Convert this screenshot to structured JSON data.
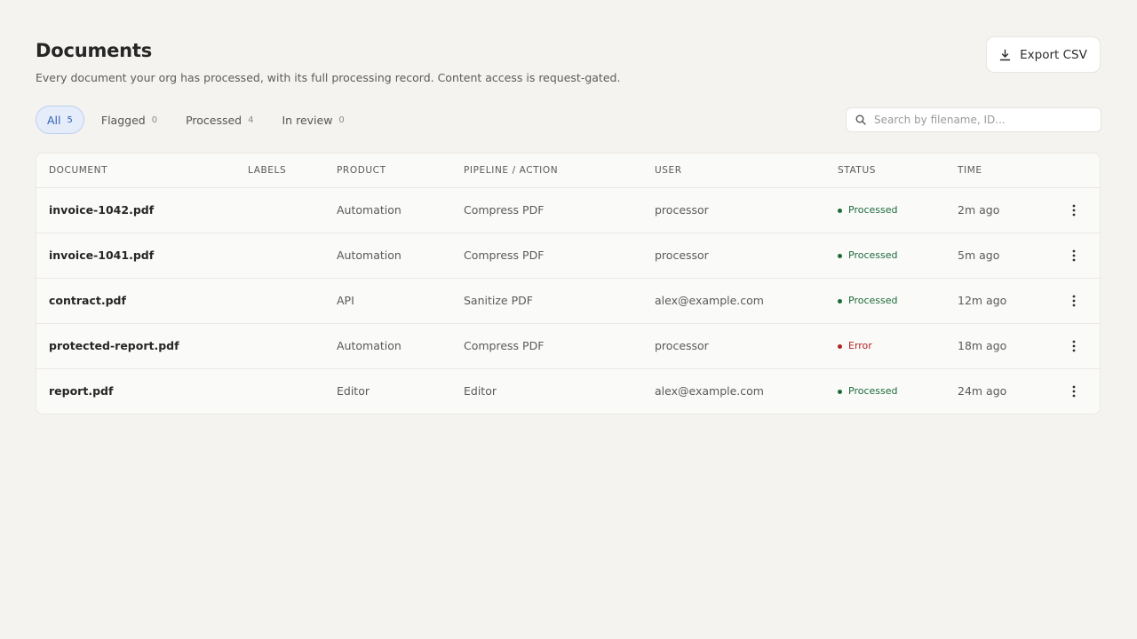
{
  "header": {
    "title": "Documents",
    "subtitle": "Every document your org has processed, with its full processing record. Content access is request-gated.",
    "export_label": "Export CSV",
    "export_icon": "download-icon"
  },
  "filters": [
    {
      "label": "All",
      "count": "5",
      "active": true
    },
    {
      "label": "Flagged",
      "count": "0",
      "active": false
    },
    {
      "label": "Processed",
      "count": "4",
      "active": false
    },
    {
      "label": "In review",
      "count": "0",
      "active": false
    }
  ],
  "search": {
    "placeholder": "Search by filename, ID...",
    "value": "",
    "icon": "search-icon"
  },
  "table": {
    "columns": {
      "document": "DOCUMENT",
      "labels": "LABELS",
      "product": "PRODUCT",
      "pipeline": "PIPELINE / ACTION",
      "user": "USER",
      "status": "STATUS",
      "time": "TIME"
    },
    "rows": [
      {
        "document": "invoice-1042.pdf",
        "labels": "",
        "product": "Automation",
        "pipeline": "Compress PDF",
        "user": "processor",
        "status": "Processed",
        "status_type": "success",
        "time": "2m ago"
      },
      {
        "document": "invoice-1041.pdf",
        "labels": "",
        "product": "Automation",
        "pipeline": "Compress PDF",
        "user": "processor",
        "status": "Processed",
        "status_type": "success",
        "time": "5m ago"
      },
      {
        "document": "contract.pdf",
        "labels": "",
        "product": "API",
        "pipeline": "Sanitize PDF",
        "user": "alex@example.com",
        "status": "Processed",
        "status_type": "success",
        "time": "12m ago"
      },
      {
        "document": "protected-report.pdf",
        "labels": "",
        "product": "Automation",
        "pipeline": "Compress PDF",
        "user": "processor",
        "status": "Error",
        "status_type": "error",
        "time": "18m ago"
      },
      {
        "document": "report.pdf",
        "labels": "",
        "product": "Editor",
        "pipeline": "Editor",
        "user": "alex@example.com",
        "status": "Processed",
        "status_type": "success",
        "time": "24m ago"
      }
    ]
  },
  "colors": {
    "background": "#f5f3ef",
    "accent": "#2f5fb3",
    "success": "#1e6b3a",
    "error": "#b42323"
  }
}
